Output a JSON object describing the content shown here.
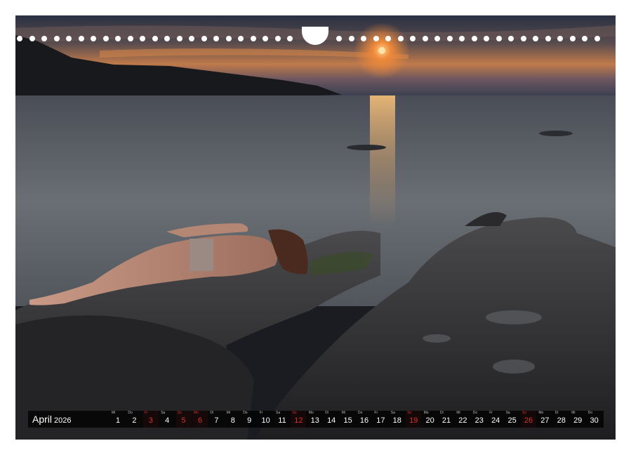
{
  "calendar": {
    "month": "April",
    "year": "2026",
    "days": [
      {
        "dow": "Mi",
        "num": "1",
        "sunday": false
      },
      {
        "dow": "Do",
        "num": "2",
        "sunday": false
      },
      {
        "dow": "Fr",
        "num": "3",
        "sunday": true
      },
      {
        "dow": "Sa",
        "num": "4",
        "sunday": false
      },
      {
        "dow": "So",
        "num": "5",
        "sunday": true
      },
      {
        "dow": "Mo",
        "num": "6",
        "sunday": true
      },
      {
        "dow": "Di",
        "num": "7",
        "sunday": false
      },
      {
        "dow": "Mi",
        "num": "8",
        "sunday": false
      },
      {
        "dow": "Do",
        "num": "9",
        "sunday": false
      },
      {
        "dow": "Fr",
        "num": "10",
        "sunday": false
      },
      {
        "dow": "Sa",
        "num": "11",
        "sunday": false
      },
      {
        "dow": "So",
        "num": "12",
        "sunday": true
      },
      {
        "dow": "Mo",
        "num": "13",
        "sunday": false
      },
      {
        "dow": "Di",
        "num": "14",
        "sunday": false
      },
      {
        "dow": "Mi",
        "num": "15",
        "sunday": false
      },
      {
        "dow": "Do",
        "num": "16",
        "sunday": false
      },
      {
        "dow": "Fr",
        "num": "17",
        "sunday": false
      },
      {
        "dow": "Sa",
        "num": "18",
        "sunday": false
      },
      {
        "dow": "So",
        "num": "19",
        "sunday": true
      },
      {
        "dow": "Mo",
        "num": "20",
        "sunday": false
      },
      {
        "dow": "Di",
        "num": "21",
        "sunday": false
      },
      {
        "dow": "Mi",
        "num": "22",
        "sunday": false
      },
      {
        "dow": "Do",
        "num": "23",
        "sunday": false
      },
      {
        "dow": "Fr",
        "num": "24",
        "sunday": false
      },
      {
        "dow": "Sa",
        "num": "25",
        "sunday": false
      },
      {
        "dow": "So",
        "num": "26",
        "sunday": true
      },
      {
        "dow": "Mo",
        "num": "27",
        "sunday": false
      },
      {
        "dow": "Di",
        "num": "28",
        "sunday": false
      },
      {
        "dow": "Mi",
        "num": "29",
        "sunday": false
      },
      {
        "dow": "Do",
        "num": "30",
        "sunday": false
      }
    ]
  },
  "colors": {
    "sunday": "#d8322a",
    "weekday": "#ffffff",
    "bar": "#000000"
  }
}
